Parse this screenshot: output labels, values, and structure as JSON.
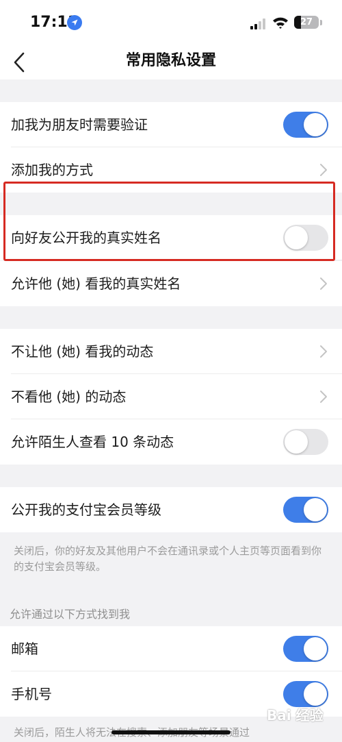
{
  "status_bar": {
    "time": "17:11",
    "battery": "27",
    "battery_level_percent": 27
  },
  "nav": {
    "title": "常用隐私设置"
  },
  "rows": [
    {
      "label": "加我为朋友时需要验证",
      "control": "toggle",
      "on": true
    },
    {
      "label": "添加我的方式",
      "control": "chevron"
    },
    {
      "label": "向好友公开我的真实姓名",
      "control": "toggle",
      "on": false
    },
    {
      "label": "允许他 (她) 看我的真实姓名",
      "control": "chevron"
    },
    {
      "label": "不让他 (她) 看我的动态",
      "control": "chevron"
    },
    {
      "label": "不看他 (她) 的动态",
      "control": "chevron"
    },
    {
      "label": "允许陌生人查看 10 条动态",
      "control": "toggle",
      "on": false
    },
    {
      "label": "公开我的支付宝会员等级",
      "control": "toggle",
      "on": true
    },
    {
      "label": "邮箱",
      "control": "toggle",
      "on": true
    },
    {
      "label": "手机号",
      "control": "toggle",
      "on": true
    }
  ],
  "member_note": "关闭后，你的好友及其他用户不会在通讯录或个人主页等页面看到你的支付宝会员等级。",
  "find_me_header": "允许通过以下方式找到我",
  "bottom_note": "关闭后，陌生人将无法在搜索、添加朋友等场景通过",
  "watermark": "Bai 经验",
  "colors": {
    "accent": "#3f7ee8",
    "toggle_off": "#e6e6e8",
    "highlight": "#d62a22",
    "background": "#f2f2f4"
  }
}
